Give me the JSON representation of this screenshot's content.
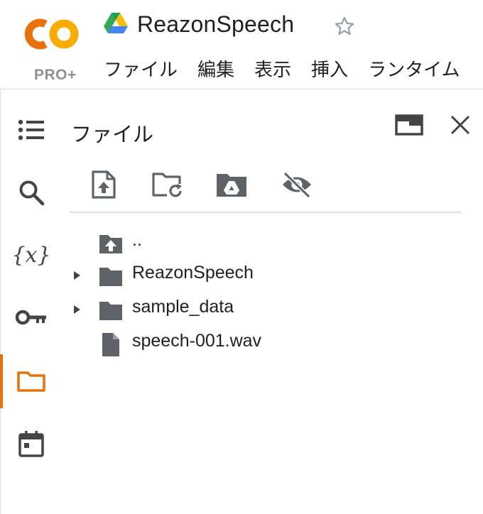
{
  "header": {
    "logo_tier": "PRO+",
    "doc_title": "ReazonSpeech",
    "menu": [
      "ファイル",
      "編集",
      "表示",
      "挿入",
      "ランタイム"
    ]
  },
  "rail": {
    "items": [
      {
        "name": "table-of-contents",
        "icon": "list-icon"
      },
      {
        "name": "search",
        "icon": "search-icon"
      },
      {
        "name": "variables",
        "icon": "variables-icon",
        "glyph": "{x}"
      },
      {
        "name": "secrets",
        "icon": "key-icon"
      },
      {
        "name": "files",
        "icon": "folder-icon",
        "active": true
      },
      {
        "name": "calendar",
        "icon": "calendar-icon"
      }
    ]
  },
  "panel": {
    "title": "ファイル",
    "toolbar": [
      "upload-file-icon",
      "refresh-folder-icon",
      "drive-folder-icon",
      "hide-eye-icon"
    ],
    "tree": [
      {
        "name": "..",
        "type": "parent",
        "expandable": false
      },
      {
        "name": "ReazonSpeech",
        "type": "folder",
        "expandable": true
      },
      {
        "name": "sample_data",
        "type": "folder",
        "expandable": true
      },
      {
        "name": "speech-001.wav",
        "type": "file",
        "expandable": false
      }
    ]
  },
  "colors": {
    "accent": "#e8710a",
    "logo_orange": "#f9ab00",
    "logo_deep_orange": "#e8710a",
    "icon_grey": "#5f6368",
    "text": "#202124"
  }
}
